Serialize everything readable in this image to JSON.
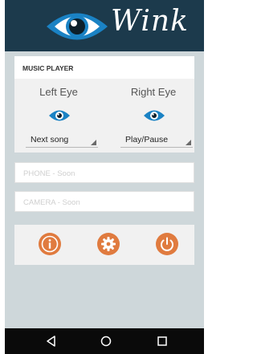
{
  "app": {
    "logo_text": "Wink"
  },
  "music_player": {
    "title": "MUSIC PLAYER",
    "left_eye": {
      "label": "Left Eye",
      "action": "Next song"
    },
    "right_eye": {
      "label": "Right Eye",
      "action": "Play/Pause"
    }
  },
  "fields": {
    "phone_placeholder": "PHONE - Soon",
    "camera_placeholder": "CAMERA - Soon"
  },
  "actions": [
    {
      "icon": "info-icon"
    },
    {
      "icon": "gear-icon"
    },
    {
      "icon": "power-icon"
    }
  ],
  "navbar": {
    "icons": [
      "back-icon",
      "home-icon",
      "recent-apps-icon"
    ]
  },
  "colors": {
    "header": "#1c3a4c",
    "accent_orange": "#e07b3f",
    "eye_blue": "#1a82c4",
    "background": "#ced7da"
  }
}
